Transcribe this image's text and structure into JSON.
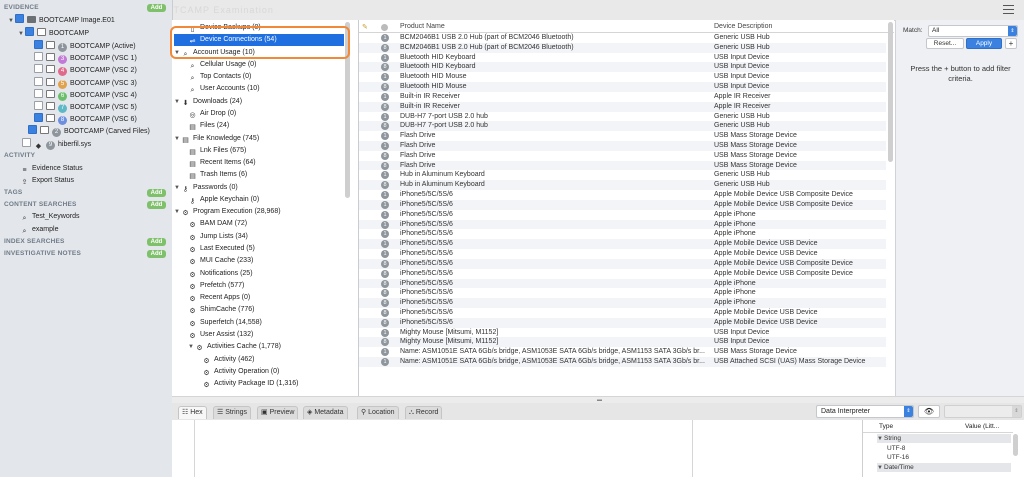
{
  "toolbar": {
    "ghost_title": "AXIOM Examine - BOOTCAMP Examination"
  },
  "sidebar": {
    "evidence_label": "EVIDENCE",
    "evidence_add": "Add",
    "image_name": "BOOTCAMP Image.E01",
    "bootcamp": "BOOTCAMP",
    "volumes": [
      {
        "num": "1",
        "label": "BOOTCAMP (Active)",
        "color": "#8e959c",
        "checked": true
      },
      {
        "num": "3",
        "label": "BOOTCAMP (VSC 1)",
        "color": "#c37ad6",
        "checked": false
      },
      {
        "num": "4",
        "label": "BOOTCAMP (VSC 2)",
        "color": "#e06a8b",
        "checked": false
      },
      {
        "num": "5",
        "label": "BOOTCAMP (VSC 3)",
        "color": "#e0a24d",
        "checked": false
      },
      {
        "num": "6",
        "label": "BOOTCAMP (VSC 4)",
        "color": "#6cbf6a",
        "checked": false
      },
      {
        "num": "7",
        "label": "BOOTCAMP (VSC 5)",
        "color": "#5eb8c6",
        "checked": false
      },
      {
        "num": "8",
        "label": "BOOTCAMP (VSC 6)",
        "color": "#6d8fe0",
        "checked": true
      }
    ],
    "carved": {
      "num": "2",
      "label": "BOOTCAMP (Carved Files)",
      "color": "#8e959c"
    },
    "hiberfil": {
      "num": "9",
      "label": "hiberfil.sys",
      "color": "#8e959c"
    },
    "activity_label": "ACTIVITY",
    "evidence_status": "Evidence Status",
    "export_status": "Export Status",
    "tags_label": "TAGS",
    "tags_add": "Add",
    "content_searches_label": "CONTENT SEARCHES",
    "content_add": "Add",
    "searches": [
      "Test_Keywords",
      "example"
    ],
    "index_searches_label": "INDEX SEARCHES",
    "index_add": "Add",
    "notes_label": "INVESTIGATIVE NOTES",
    "notes_add": "Add"
  },
  "tree": [
    {
      "label": "Device Backups (0)",
      "indent": 1,
      "icon": "device-icon"
    },
    {
      "label": "Device Connections (54)",
      "indent": 1,
      "icon": "usb-icon",
      "selected": true
    },
    {
      "label": "Account Usage (10)",
      "indent": 0,
      "icon": "account-icon",
      "tri": "▼"
    },
    {
      "label": "Cellular Usage (0)",
      "indent": 1,
      "icon": "search-icon"
    },
    {
      "label": "Top Contacts (0)",
      "indent": 1,
      "icon": "search-icon"
    },
    {
      "label": "User Accounts (10)",
      "indent": 1,
      "icon": "search-icon"
    },
    {
      "label": "Downloads (24)",
      "indent": 0,
      "icon": "download-icon",
      "tri": "▼"
    },
    {
      "label": "Air Drop (0)",
      "indent": 1,
      "icon": "airdrop-icon"
    },
    {
      "label": "Files (24)",
      "indent": 1,
      "icon": "file-icon"
    },
    {
      "label": "File Knowledge (745)",
      "indent": 0,
      "icon": "file-icon",
      "tri": "▼"
    },
    {
      "label": "Lnk Files (675)",
      "indent": 1,
      "icon": "file-icon"
    },
    {
      "label": "Recent Items (64)",
      "indent": 1,
      "icon": "file-icon"
    },
    {
      "label": "Trash Items (6)",
      "indent": 1,
      "icon": "file-icon"
    },
    {
      "label": "Passwords (0)",
      "indent": 0,
      "icon": "key-icon",
      "tri": "▼"
    },
    {
      "label": "Apple Keychain (0)",
      "indent": 1,
      "icon": "key-icon"
    },
    {
      "label": "Program Execution (28,968)",
      "indent": 0,
      "icon": "program-icon",
      "tri": "▼"
    },
    {
      "label": "BAM DAM (72)",
      "indent": 1,
      "icon": "program-icon"
    },
    {
      "label": "Jump Lists (34)",
      "indent": 1,
      "icon": "program-icon"
    },
    {
      "label": "Last Executed (5)",
      "indent": 1,
      "icon": "program-icon"
    },
    {
      "label": "MUI Cache (233)",
      "indent": 1,
      "icon": "program-icon"
    },
    {
      "label": "Notifications (25)",
      "indent": 1,
      "icon": "program-icon"
    },
    {
      "label": "Prefetch (577)",
      "indent": 1,
      "icon": "program-icon"
    },
    {
      "label": "Recent Apps (0)",
      "indent": 1,
      "icon": "program-icon"
    },
    {
      "label": "ShimCache (776)",
      "indent": 1,
      "icon": "program-icon"
    },
    {
      "label": "Superfetch (14,558)",
      "indent": 1,
      "icon": "program-icon"
    },
    {
      "label": "User Assist (132)",
      "indent": 1,
      "icon": "program-icon"
    },
    {
      "label": "Activities Cache (1,778)",
      "indent": 1,
      "icon": "program-icon",
      "tri": "▼"
    },
    {
      "label": "Activity (462)",
      "indent": 2,
      "icon": "program-icon"
    },
    {
      "label": "Activity Operation (0)",
      "indent": 2,
      "icon": "program-icon"
    },
    {
      "label": "Activity Package ID (1,316)",
      "indent": 2,
      "icon": "program-icon"
    }
  ],
  "results": {
    "col_product": "Product Name",
    "col_desc": "Device Description",
    "rows": [
      {
        "b": "1",
        "p": "BCM2046B1 USB 2.0 Hub (part of BCM2046 Bluetooth)",
        "d": "Generic USB Hub"
      },
      {
        "b": "8",
        "p": "BCM2046B1 USB 2.0 Hub (part of BCM2046 Bluetooth)",
        "d": "Generic USB Hub"
      },
      {
        "b": "1",
        "p": "Bluetooth HID Keyboard",
        "d": "USB Input Device"
      },
      {
        "b": "8",
        "p": "Bluetooth HID Keyboard",
        "d": "USB Input Device"
      },
      {
        "b": "1",
        "p": "Bluetooth HID Mouse",
        "d": "USB Input Device"
      },
      {
        "b": "8",
        "p": "Bluetooth HID Mouse",
        "d": "USB Input Device"
      },
      {
        "b": "1",
        "p": "Built-in IR Receiver",
        "d": "Apple IR Receiver"
      },
      {
        "b": "8",
        "p": "Built-in IR Receiver",
        "d": "Apple IR Receiver"
      },
      {
        "b": "1",
        "p": "DUB-H7 7-port USB 2.0 hub",
        "d": "Generic USB Hub"
      },
      {
        "b": "8",
        "p": "DUB-H7 7-port USB 2.0 hub",
        "d": "Generic USB Hub"
      },
      {
        "b": "1",
        "p": "Flash Drive",
        "d": "USB Mass Storage Device"
      },
      {
        "b": "1",
        "p": "Flash Drive",
        "d": "USB Mass Storage Device"
      },
      {
        "b": "8",
        "p": "Flash Drive",
        "d": "USB Mass Storage Device"
      },
      {
        "b": "8",
        "p": "Flash Drive",
        "d": "USB Mass Storage Device"
      },
      {
        "b": "1",
        "p": "Hub in Aluminum Keyboard",
        "d": "Generic USB Hub"
      },
      {
        "b": "8",
        "p": "Hub in Aluminum Keyboard",
        "d": "Generic USB Hub"
      },
      {
        "b": "1",
        "p": "iPhone5/5C/5S/6",
        "d": "Apple Mobile Device USB Composite Device"
      },
      {
        "b": "1",
        "p": "iPhone5/5C/5S/6",
        "d": "Apple Mobile Device USB Composite Device"
      },
      {
        "b": "1",
        "p": "iPhone5/5C/5S/6",
        "d": "Apple iPhone"
      },
      {
        "b": "1",
        "p": "iPhone5/5C/5S/6",
        "d": "Apple iPhone"
      },
      {
        "b": "1",
        "p": "iPhone5/5C/5S/6",
        "d": "Apple iPhone"
      },
      {
        "b": "1",
        "p": "iPhone5/5C/5S/6",
        "d": "Apple Mobile Device USB Device"
      },
      {
        "b": "1",
        "p": "iPhone5/5C/5S/6",
        "d": "Apple Mobile Device USB Device"
      },
      {
        "b": "8",
        "p": "iPhone5/5C/5S/6",
        "d": "Apple Mobile Device USB Composite Device"
      },
      {
        "b": "8",
        "p": "iPhone5/5C/5S/6",
        "d": "Apple Mobile Device USB Composite Device"
      },
      {
        "b": "8",
        "p": "iPhone5/5C/5S/6",
        "d": "Apple iPhone"
      },
      {
        "b": "8",
        "p": "iPhone5/5C/5S/6",
        "d": "Apple iPhone"
      },
      {
        "b": "8",
        "p": "iPhone5/5C/5S/6",
        "d": "Apple iPhone"
      },
      {
        "b": "8",
        "p": "iPhone5/5C/5S/6",
        "d": "Apple Mobile Device USB Device"
      },
      {
        "b": "8",
        "p": "iPhone5/5C/5S/6",
        "d": "Apple Mobile Device USB Device"
      },
      {
        "b": "1",
        "p": "Mighty Mouse [Mitsumi, M1152]",
        "d": "USB Input Device"
      },
      {
        "b": "8",
        "p": "Mighty Mouse [Mitsumi, M1152]",
        "d": "USB Input Device"
      },
      {
        "b": "1",
        "p": "Name: ASM1051E SATA 6Gb/s bridge, ASM1053E SATA 6Gb/s bridge, ASM1153 SATA 3Gb/s br...",
        "d": "USB Mass Storage Device"
      },
      {
        "b": "1",
        "p": "Name: ASM1051E SATA 6Gb/s bridge, ASM1053E SATA 6Gb/s bridge, ASM1153 SATA 3Gb/s br...",
        "d": "USB Attached SCSI (UAS) Mass Storage Device"
      }
    ]
  },
  "filter": {
    "match_label": "Match:",
    "match_value": "All",
    "reset": "Reset...",
    "apply": "Apply",
    "plus": "+",
    "hint": "Press the + button to add filter criteria."
  },
  "bottom": {
    "tabs": [
      "Hex",
      "Strings",
      "Preview",
      "Metadata",
      "Location",
      "Record"
    ],
    "interpreter": "Data Interpreter",
    "col_type": "Type",
    "col_value": "Value (Litt...",
    "interp_rows": [
      {
        "label": "String",
        "group": true
      },
      {
        "label": "UTF-8",
        "group": false
      },
      {
        "label": "UTF-16",
        "group": false
      },
      {
        "label": "Date/Time",
        "group": true
      }
    ]
  }
}
